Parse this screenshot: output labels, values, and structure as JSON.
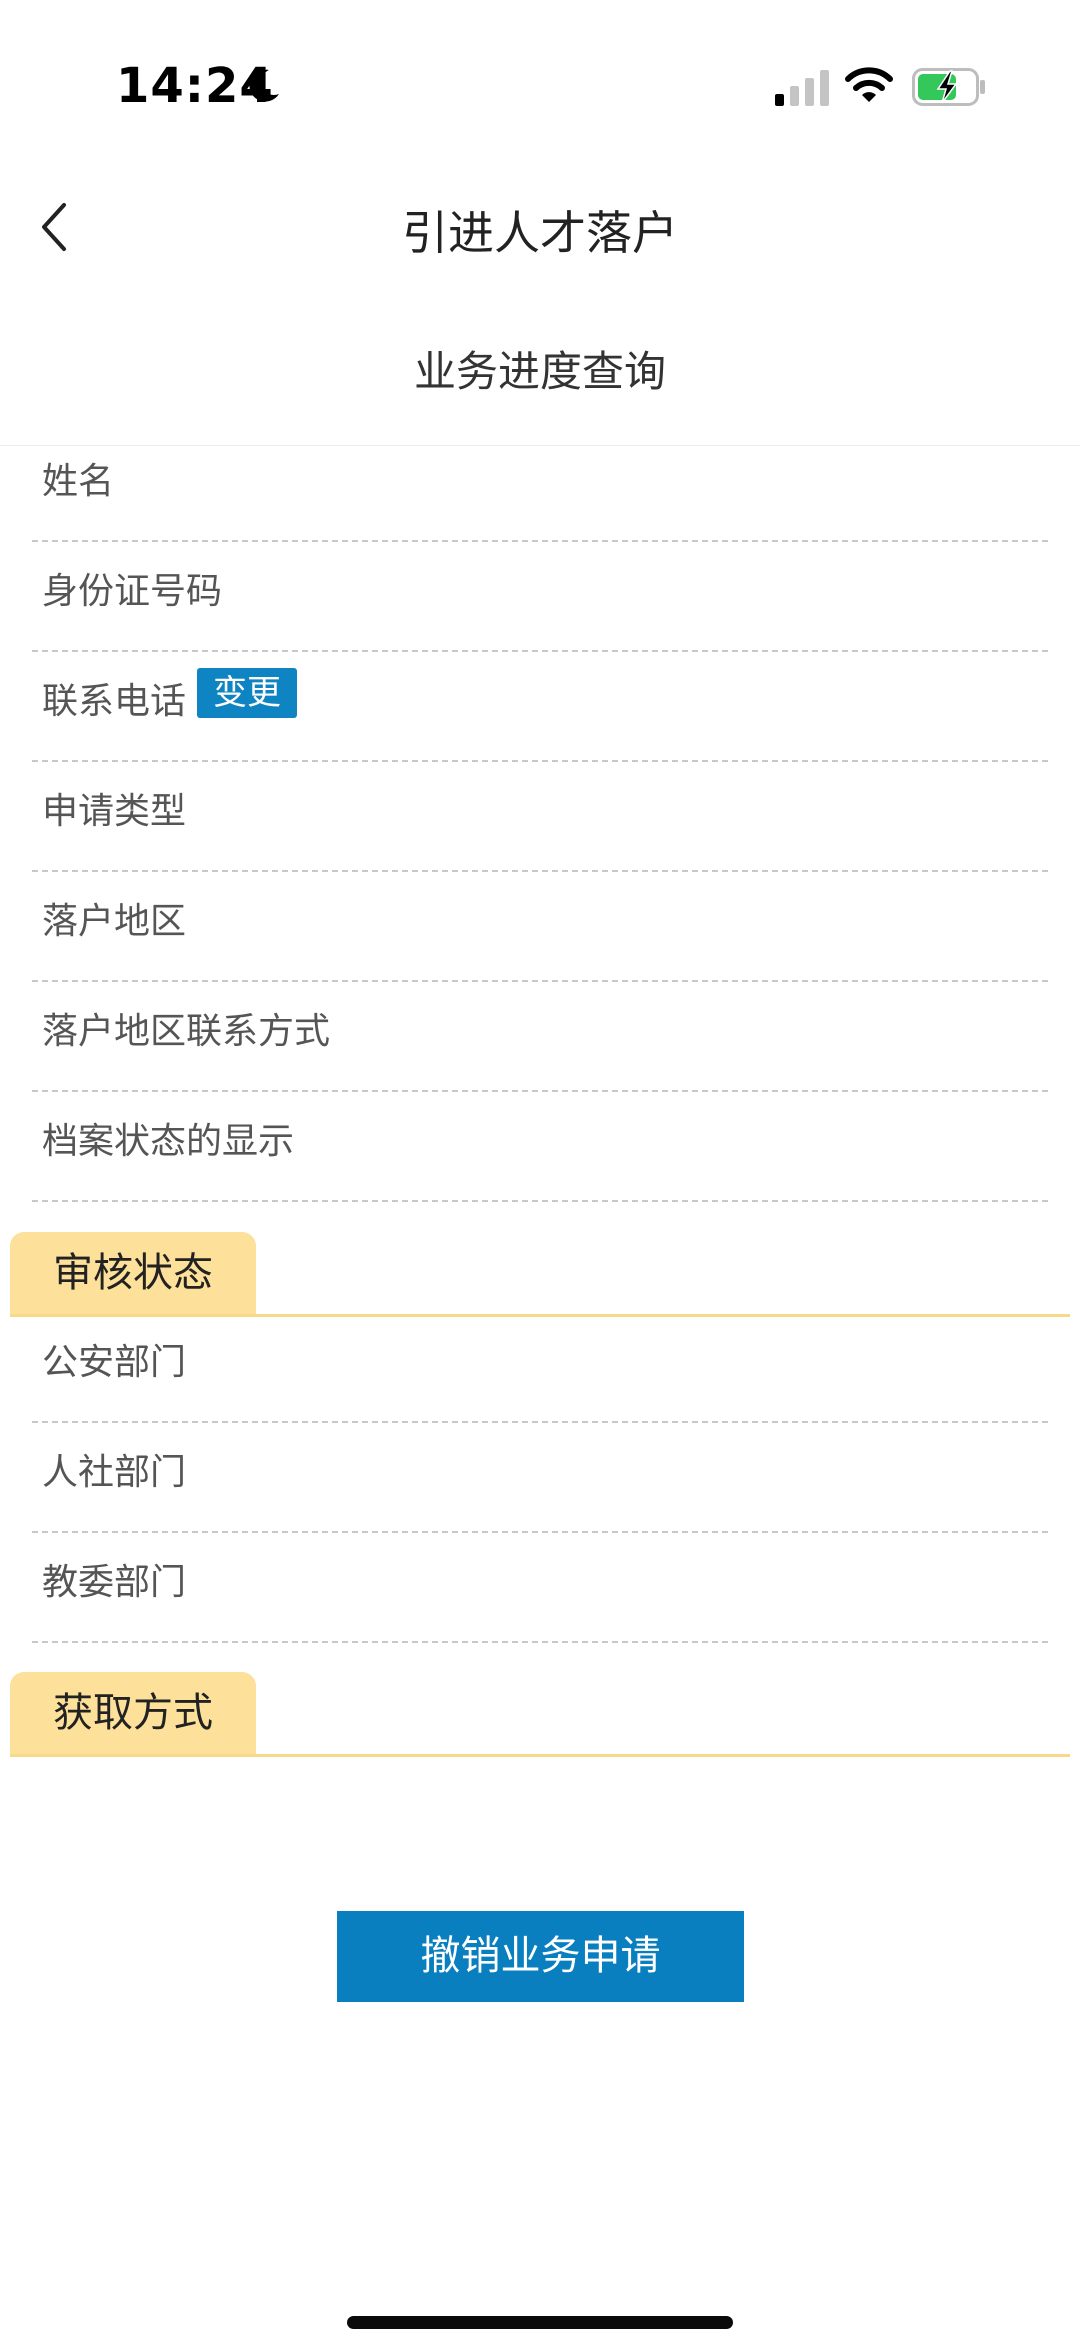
{
  "status_bar": {
    "time": "14:24",
    "icons": [
      "moon-icon",
      "cellular-signal-icon",
      "wifi-icon",
      "battery-charging-icon"
    ]
  },
  "nav": {
    "title": "引进人才落户",
    "back_icon": "chevron-left-icon"
  },
  "section_title": "业务进度查询",
  "info_rows": [
    {
      "label": "姓名"
    },
    {
      "label": "身份证号码"
    },
    {
      "label": "联系电话",
      "action": "变更"
    },
    {
      "label": "申请类型"
    },
    {
      "label": "落户地区"
    },
    {
      "label": "落户地区联系方式"
    },
    {
      "label": "档案状态的显示"
    }
  ],
  "review_group": {
    "title": "审核状态",
    "rows": [
      {
        "label": "公安部门"
      },
      {
        "label": "人社部门"
      },
      {
        "label": "教委部门"
      }
    ]
  },
  "pickup_group": {
    "title": "获取方式"
  },
  "revoke_button": "撤销业务申请",
  "colors": {
    "primary_blue": "#0a7fc0",
    "tab_yellow": "#fde09a",
    "tab_line": "#f6d98a",
    "battery_green": "#34c759"
  }
}
